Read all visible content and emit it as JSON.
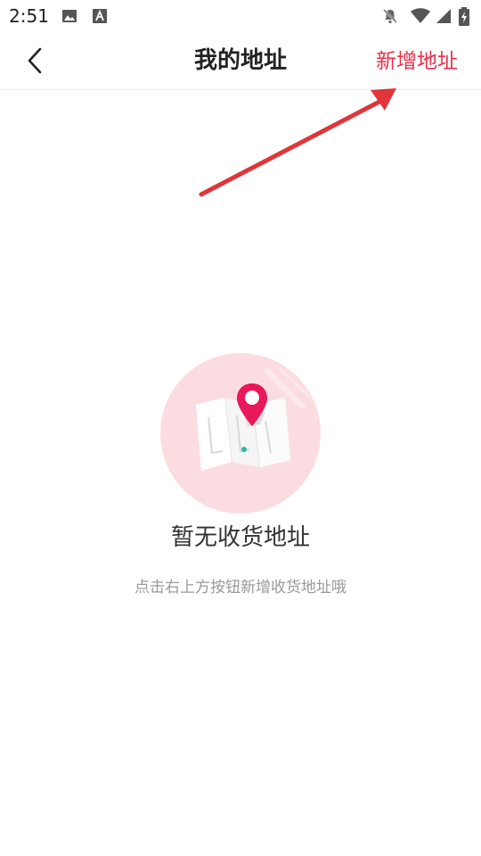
{
  "status_bar": {
    "time": "2:51",
    "icons": [
      "image-icon",
      "text-a-icon",
      "notifications-off-icon",
      "wifi-icon",
      "signal-icon",
      "battery-charging-icon"
    ]
  },
  "header": {
    "title": "我的地址",
    "action_label": "新增地址",
    "action_color": "#e8304a",
    "back_icon": "chevron-left-icon"
  },
  "annotation": {
    "arrow_color": "#e0353a"
  },
  "empty_state": {
    "icon": "map-pin-illustration",
    "title": "暂无收货地址",
    "hint": "点击右上方按钮新增收货地址哦",
    "accent_color": "#e8185a",
    "circle_color": "#fbdde1"
  }
}
